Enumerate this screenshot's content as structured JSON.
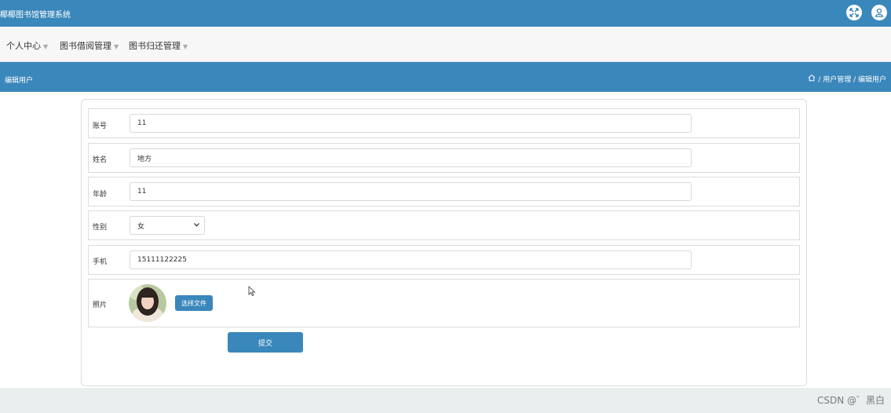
{
  "app": {
    "title": "椰椰图书馆管理系统"
  },
  "topbar": {
    "icons": [
      "fullscreen-icon",
      "user-icon"
    ]
  },
  "menu": [
    {
      "label": "个人中心",
      "icon": "caret-down-icon"
    },
    {
      "label": "图书借阅管理",
      "icon": "caret-down-icon"
    },
    {
      "label": "图书归还管理",
      "icon": "caret-down-icon"
    }
  ],
  "page": {
    "title": "编辑用户"
  },
  "breadcrumb": {
    "icon": "home-icon",
    "text": "/ 用户管理 / 编辑用户"
  },
  "form": {
    "account": {
      "label": "账号",
      "value": "11"
    },
    "name": {
      "label": "姓名",
      "value": "地方"
    },
    "age": {
      "label": "年龄",
      "value": "11"
    },
    "gender": {
      "label": "性别",
      "value": "女"
    },
    "phone": {
      "label": "手机",
      "value": "15111122225"
    },
    "photo": {
      "label": "照片",
      "button": "选择文件"
    },
    "submit": "提交"
  },
  "watermark": "CSDN @゛黑白",
  "colors": {
    "primary": "#3a87bb",
    "background": "#e8efee"
  }
}
